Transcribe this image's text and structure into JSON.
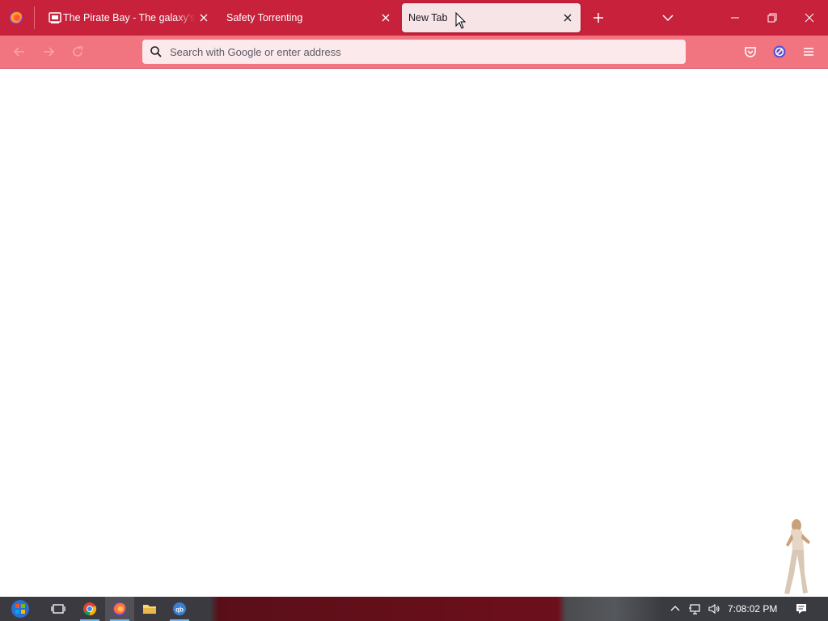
{
  "browser": {
    "tabs": [
      {
        "title": "The Pirate Bay - The galaxy's m",
        "active": false
      },
      {
        "title": "Safety Torrenting",
        "active": false
      },
      {
        "title": "New Tab",
        "active": true
      }
    ],
    "urlbar_placeholder": "Search with Google or enter address"
  },
  "colors": {
    "tabstrip": "#c8213b",
    "navbar": "#f07580",
    "urlbar": "#fbe9eb",
    "active_tab": "#f7e4e7"
  },
  "taskbar": {
    "apps": [
      "start-icon",
      "task-view-icon",
      "chrome-icon",
      "firefox-icon",
      "file-explorer-icon",
      "qbittorrent-icon"
    ],
    "clock": "7:08:02 PM"
  }
}
